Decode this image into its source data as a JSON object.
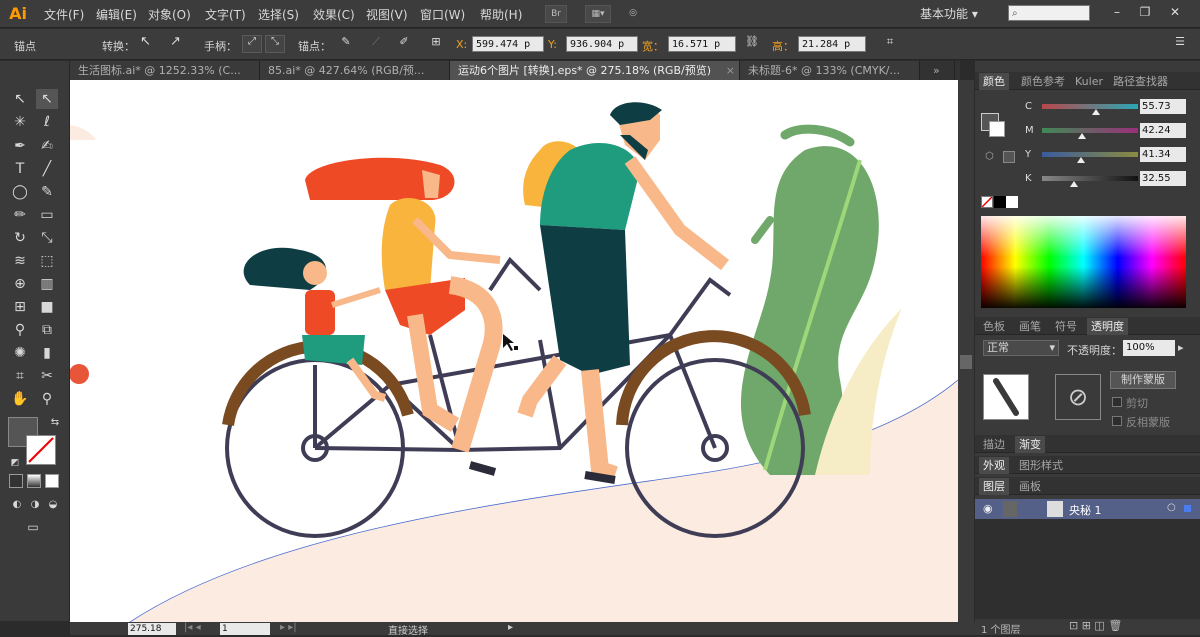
{
  "app": {
    "logo": "Ai"
  },
  "menu": [
    "文件(F)",
    "编辑(E)",
    "对象(O)",
    "文字(T)",
    "选择(S)",
    "效果(C)",
    "视图(V)",
    "窗口(W)",
    "帮助(H)"
  ],
  "menu_br": "Br",
  "workspace": "基本功能",
  "control": {
    "anchor_label": "锚点",
    "convert_label": "转换：",
    "handles_label": "手柄：",
    "anchor2_label": "锚点：",
    "x_label": "X:",
    "x_value": "599.474 p",
    "y_label": "Y:",
    "y_value": "936.904 p",
    "w_label": "宽：",
    "w_value": "16.571 p",
    "h_label": "高：",
    "h_value": "21.284 p"
  },
  "tabs": [
    {
      "label": "生活图标.ai* @ 1252.33% (C...",
      "active": false
    },
    {
      "label": "85.ai* @ 427.64% (RGB/预...",
      "active": false
    },
    {
      "label": "运动6个图片 [转换].eps* @ 275.18% (RGB/预览)",
      "active": true
    },
    {
      "label": "未标题-6* @ 133% (CMYK/...",
      "active": false
    }
  ],
  "tab_close": "×",
  "color_panel": {
    "tabs": [
      "颜色",
      "颜色参考",
      "Kuler",
      "路径查找器"
    ],
    "active_tab": "颜色",
    "channels": [
      {
        "name": "C",
        "value": "55.73",
        "pos": 0.56,
        "grad": "linear-gradient(to right,#b8474a,#2aa7b6)"
      },
      {
        "name": "M",
        "value": "42.24",
        "pos": 0.42,
        "grad": "linear-gradient(to right,#3f8a55,#9b2f7a)"
      },
      {
        "name": "Y",
        "value": "41.34",
        "pos": 0.41,
        "grad": "linear-gradient(to right,#3a5c9e,#8b8b40)"
      },
      {
        "name": "K",
        "value": "32.55",
        "pos": 0.33,
        "grad": "linear-gradient(to right,#888,#111)"
      }
    ]
  },
  "transparency_panel": {
    "tabs": [
      "色板",
      "画笔",
      "符号",
      "透明度"
    ],
    "active_tab": "透明度",
    "blend_mode": "正常",
    "opacity_label": "不透明度：",
    "opacity_value": "100%",
    "make_mask": "制作蒙版",
    "clip": "剪切",
    "invert_mask": "反相蒙版"
  },
  "stroke_tabs": [
    "描边",
    "渐变"
  ],
  "appearance_tabs": [
    "外观",
    "图形样式"
  ],
  "layers_tabs": [
    "图层",
    "画板"
  ],
  "layer": {
    "name": "央秘 1"
  },
  "layers_footer": "1 个图层",
  "status": {
    "zoom": "275.18",
    "page": "1",
    "tool": "直接选择"
  },
  "colors": {
    "canvas_bg": "#ffffff",
    "ground": "#fcebe0",
    "accent_orange": "#e8563a",
    "hair_red": "#ee4a25",
    "teal": "#1f9b7e",
    "dark_teal": "#0f3d44",
    "green": "#6fa86a",
    "bike": "#3f3d55",
    "fender": "#7a4a20"
  }
}
